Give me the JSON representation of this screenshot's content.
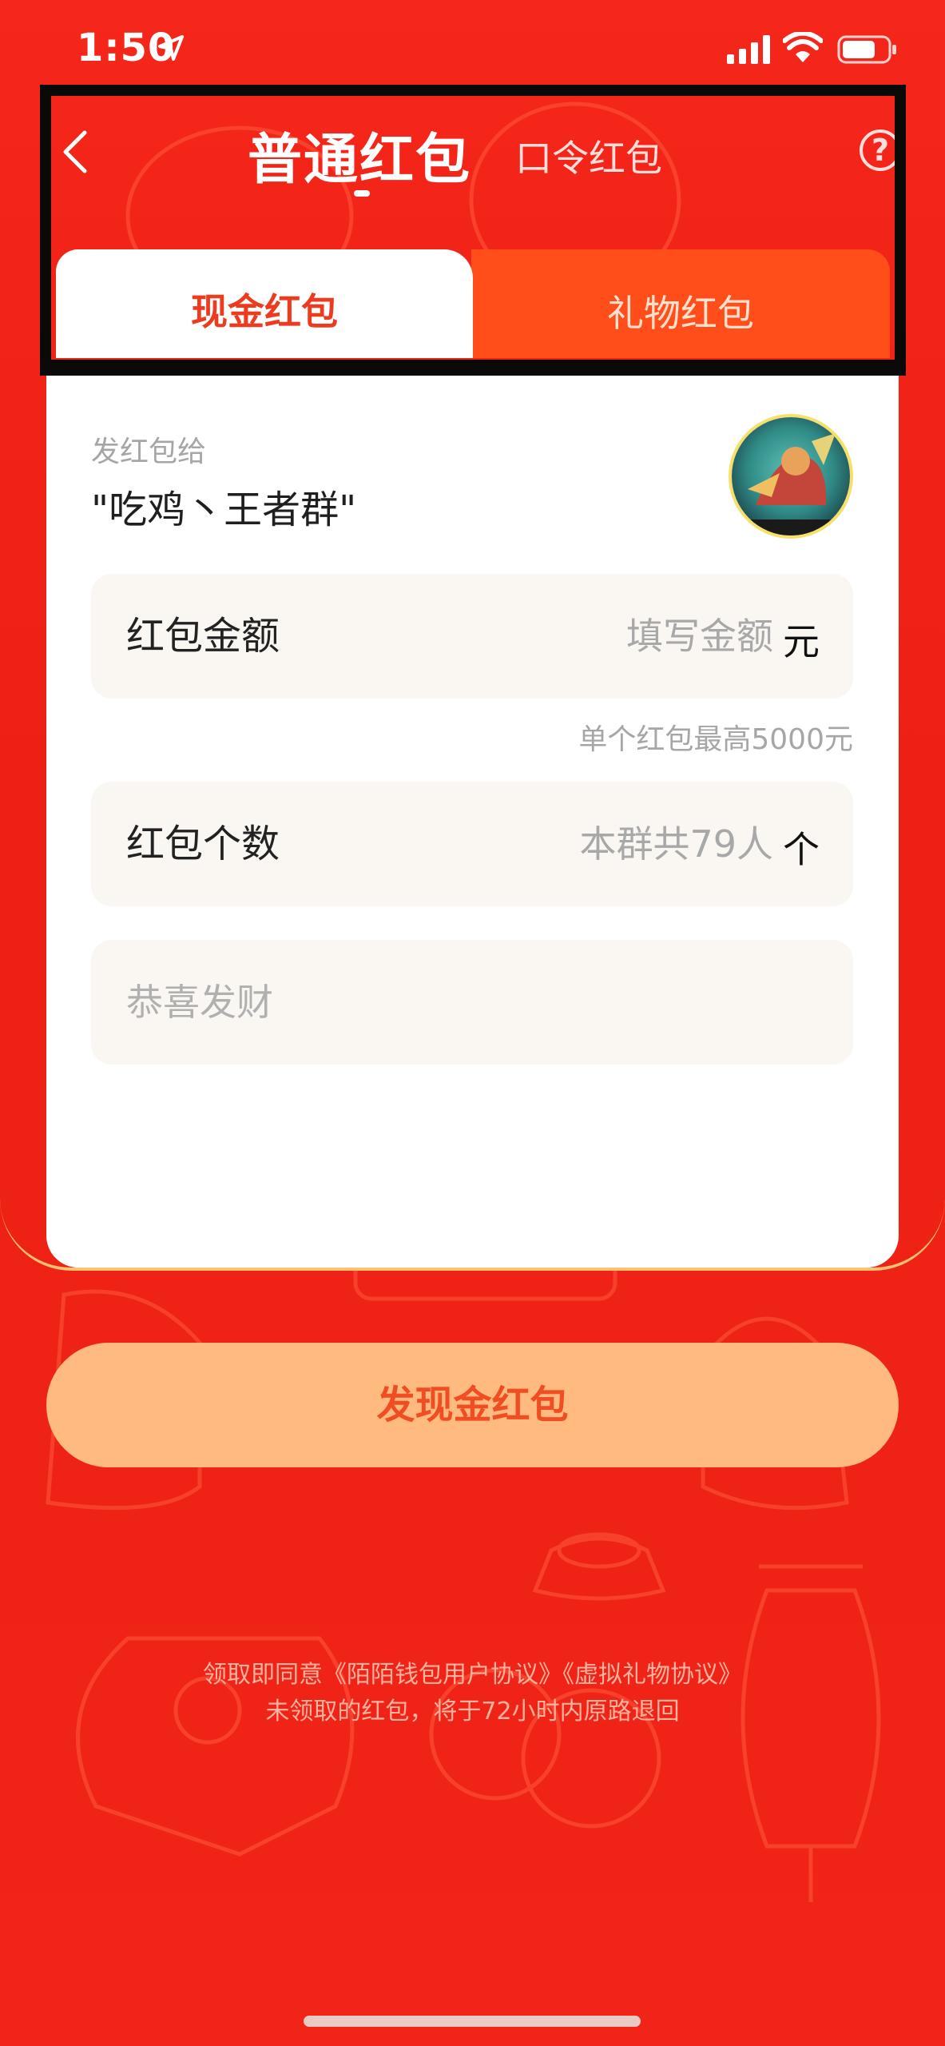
{
  "status_bar": {
    "time": "1:50",
    "location_icon": "location-arrow-icon",
    "signal_icon": "cellular-signal-icon",
    "wifi_icon": "wifi-icon",
    "battery_icon": "battery-icon"
  },
  "header": {
    "title_active": "普通红包",
    "title_inactive": "口令红包",
    "help_symbol": "?",
    "back_icon": "chevron-left-icon"
  },
  "tabs": [
    {
      "label": "现金红包",
      "active": true
    },
    {
      "label": "礼物红包",
      "active": false
    }
  ],
  "recipient": {
    "label": "发红包给",
    "group_name": "\"吃鸡丶王者群\"",
    "avatar_icon": "group-avatar-icon"
  },
  "form": {
    "amount": {
      "label": "红包金额",
      "placeholder": "填写金额",
      "unit": "元",
      "note": "单个红包最高5000元"
    },
    "count": {
      "label": "红包个数",
      "placeholder": "本群共79人",
      "unit": "个"
    },
    "greeting": {
      "placeholder": "恭喜发财"
    }
  },
  "send_button": "发现金红包",
  "agreement": {
    "line1": "领取即同意《陌陌钱包用户协议》《虚拟礼物协议》",
    "line2": "未领取的红包，将于72小时内原路退回"
  },
  "colors": {
    "background": "#ef2416",
    "accent": "#ec3b1f",
    "button": "#ffba7f",
    "button_text": "#f04d22",
    "inactive_tab": "#ff4e1a"
  }
}
